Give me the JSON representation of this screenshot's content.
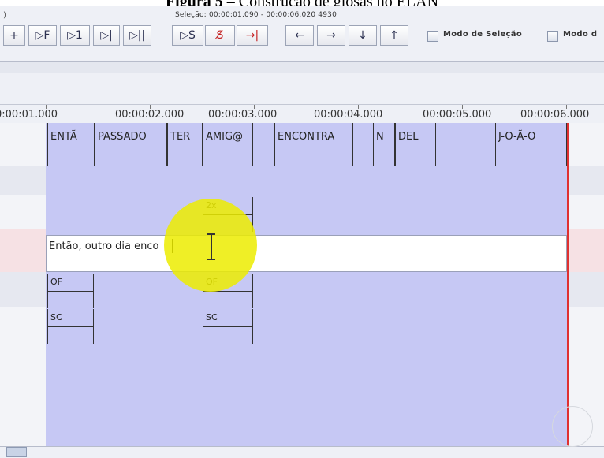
{
  "caption": {
    "label": "Figura 5",
    "text": " – Construção de glosas no ELAN"
  },
  "toolbar": {
    "selection_text": "Seleção: 00:00:01.090 - 00:00:06.020  4930",
    "left_glyph": ")",
    "buttons": [
      {
        "label": "+"
      },
      {
        "label": "▷F"
      },
      {
        "label": "▷1"
      },
      {
        "label": "▷|"
      },
      {
        "label": "▷||"
      },
      {
        "label": "▷S"
      },
      {
        "label": "S̸"
      },
      {
        "label": "→|"
      },
      {
        "label": "←"
      },
      {
        "label": "→"
      },
      {
        "label": "↓"
      },
      {
        "label": "↑"
      }
    ],
    "checkboxes": [
      {
        "label": "Modo de Seleção",
        "checked": false
      },
      {
        "label": "Modo d",
        "checked": false
      }
    ]
  },
  "ruler": {
    "ticks": [
      "0:00:01.000",
      "00:00:02.000",
      "00:00:03.000",
      "00:00:04.000",
      "00:00:05.000",
      "00:00:06.000"
    ]
  },
  "tiers": {
    "glosses": [
      "ENTÃ",
      "PASSADO",
      "TER",
      "AMIG@",
      "ENCONTRA",
      "N",
      "DEL",
      "J-O-Ã-O"
    ],
    "repetition": [
      "2x"
    ],
    "of": [
      "OF",
      "OF"
    ],
    "sc": [
      "SC",
      "SC"
    ]
  },
  "editor": {
    "value": "Então, outro dia enco"
  },
  "colors": {
    "selection": "#c6c8f4",
    "cursor_line": "#e03030",
    "highlight": "#ecec00"
  }
}
